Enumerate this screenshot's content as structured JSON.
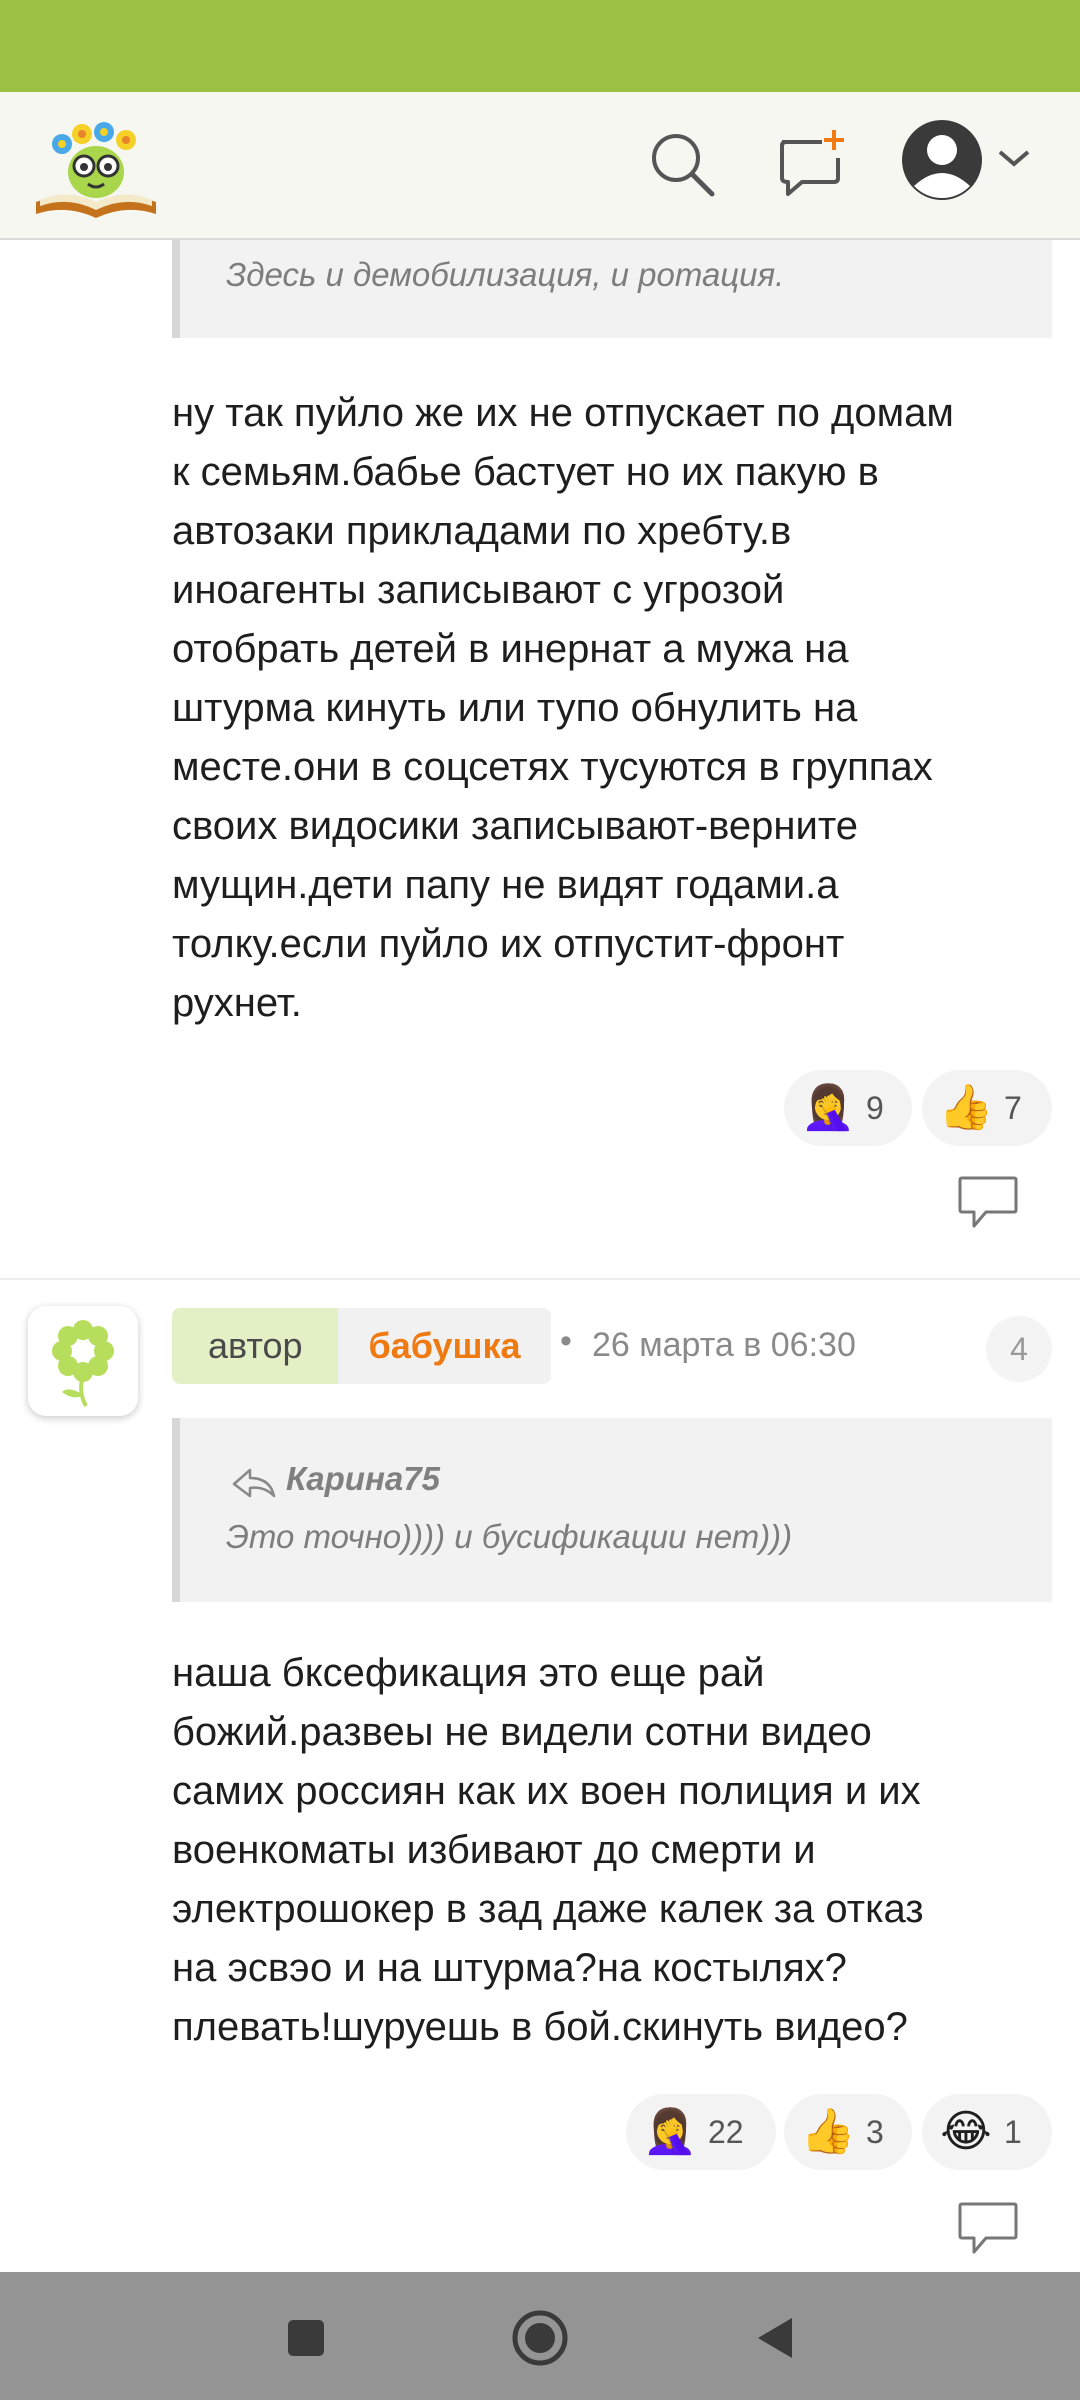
{
  "comment1": {
    "quote_text": "Здесь и демобилизация, и ротация.",
    "text_lines": [
      "ну так пуйло же их не отпускает по домам",
      "к семьям.бабье бастует но их пакую в",
      "автозаки прикладами по хребту.в",
      "иноагенты записывают с угрозой",
      "отобрать детей в инернат а мужа на",
      "штурма кинуть или тупо обнулить на",
      "месте.они в соцсетях тусуются в группах",
      "своих видосики записывают-верните",
      "мущин.дети папу не видят годами.а",
      "толку.если пуйло их отпустит-фронт",
      "рухнет."
    ],
    "reactions": [
      {
        "emoji": "🤦‍♀️",
        "count": "9"
      },
      {
        "emoji": "👍",
        "count": "7"
      }
    ]
  },
  "comment2": {
    "role_badge": "автор",
    "username": "бабушка",
    "separator": "•",
    "timestamp": "26 марта в 06:30",
    "reply_count": "4",
    "quote_author": "Карина75",
    "quote_text": "Это точно)))) и бусификации нет)))",
    "text_lines": [
      "наша бксефикация это еще рай",
      "божий.развеы не видели сотни видео",
      "самих россиян как их воен полиция и их",
      "военкоматы избивают до смерти и",
      "электрошокер в зад даже калек за отказ",
      "на эсвэо и на штурма?на костылях?",
      "плевать!шуруешь в бой.скинуть видео?"
    ],
    "reactions": [
      {
        "emoji": "🤦‍♀️",
        "count": "22"
      },
      {
        "emoji": "👍",
        "count": "3"
      },
      {
        "emoji": "😂",
        "count": "1"
      }
    ]
  },
  "colors": {
    "status_bar": "#9dc143",
    "username": "#f07a12",
    "role_badge_bg": "#e3f0c6",
    "nav_bar": "#949494"
  },
  "icons": [
    "logo-icon",
    "search-icon",
    "new-post-icon",
    "avatar-icon",
    "chevron-down-icon",
    "reply-arrow-icon",
    "comment-icon",
    "stop-icon",
    "home-icon",
    "back-icon"
  ]
}
